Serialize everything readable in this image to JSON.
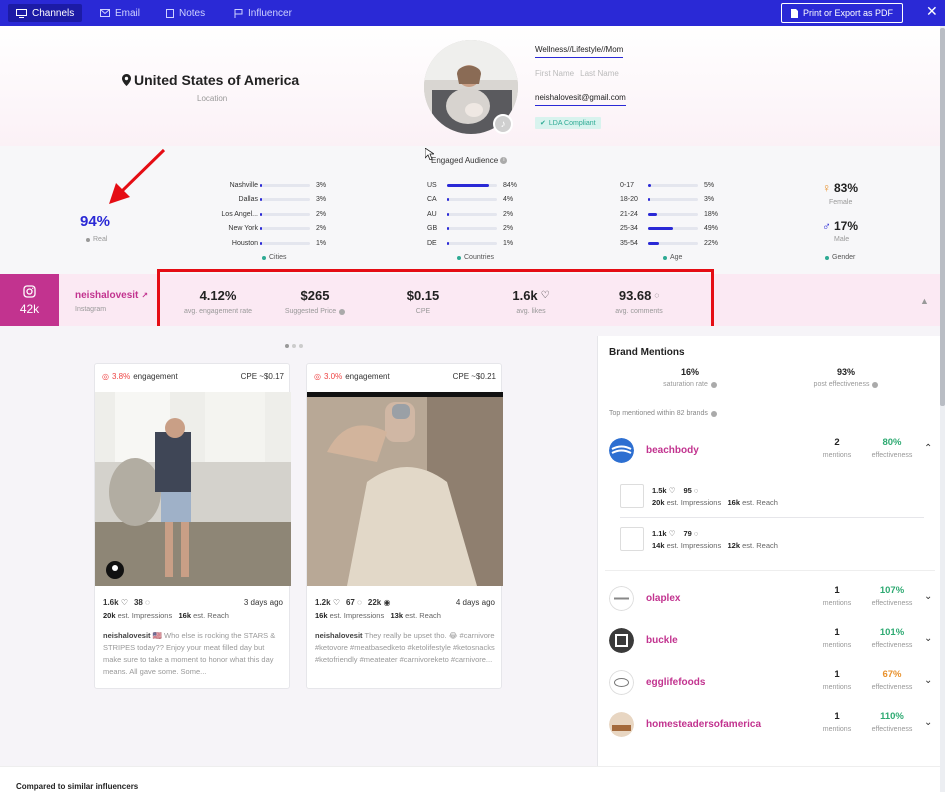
{
  "topbar": {
    "tabs": [
      {
        "label": "Channels",
        "icon": "monitor-icon",
        "active": true
      },
      {
        "label": "Email",
        "icon": "mail-icon"
      },
      {
        "label": "Notes",
        "icon": "note-icon"
      },
      {
        "label": "Influencer",
        "icon": "flag-icon"
      }
    ],
    "print_label": "Print or Export as PDF",
    "close_glyph": "✕"
  },
  "profile": {
    "location": "United States of America",
    "location_label": "Location",
    "category": "Wellness//Lifestyle//Mom",
    "first_name_placeholder": "First Name",
    "last_name_placeholder": "Last Name",
    "email": "neishalovesit@gmail.com",
    "lda": "LDA Compliant"
  },
  "audience": {
    "title": "Engaged Audience",
    "real": {
      "value": "94%",
      "label": "Real"
    },
    "cities": {
      "label": "Cities",
      "rows": [
        {
          "name": "Nashville",
          "pct": "3%",
          "fill": 0.03
        },
        {
          "name": "Dallas",
          "pct": "3%",
          "fill": 0.03
        },
        {
          "name": "Los Angel...",
          "pct": "2%",
          "fill": 0.02
        },
        {
          "name": "New York",
          "pct": "2%",
          "fill": 0.02
        },
        {
          "name": "Houston",
          "pct": "1%",
          "fill": 0.01
        }
      ]
    },
    "countries": {
      "label": "Countries",
      "rows": [
        {
          "name": "US",
          "pct": "84%",
          "fill": 0.84
        },
        {
          "name": "CA",
          "pct": "4%",
          "fill": 0.04
        },
        {
          "name": "AU",
          "pct": "2%",
          "fill": 0.02
        },
        {
          "name": "GB",
          "pct": "2%",
          "fill": 0.02
        },
        {
          "name": "DE",
          "pct": "1%",
          "fill": 0.01
        }
      ]
    },
    "age": {
      "label": "Age",
      "rows": [
        {
          "name": "0-17",
          "pct": "5%",
          "fill": 0.05
        },
        {
          "name": "18-20",
          "pct": "3%",
          "fill": 0.03
        },
        {
          "name": "21-24",
          "pct": "18%",
          "fill": 0.18
        },
        {
          "name": "25-34",
          "pct": "49%",
          "fill": 0.49
        },
        {
          "name": "35-54",
          "pct": "22%",
          "fill": 0.22
        }
      ]
    },
    "gender": {
      "label": "Gender",
      "female": {
        "value": "83%",
        "label": "Female",
        "color": "#e8912c"
      },
      "male": {
        "value": "17%",
        "label": "Male",
        "color": "#2a29d6"
      }
    }
  },
  "instagram": {
    "followers": "42k",
    "handle": "neishalovesit",
    "platform": "Instagram",
    "stats": [
      {
        "value": "4.12%",
        "label": "avg. engagement rate"
      },
      {
        "value": "$265",
        "label": "Suggested Price"
      },
      {
        "value": "$0.15",
        "label": "CPE"
      },
      {
        "value": "1.6k",
        "label": "avg. likes"
      },
      {
        "value": "93.68",
        "label": "avg. comments"
      }
    ]
  },
  "posts": [
    {
      "engagement_pct": "3.8%",
      "engagement_label": "engagement",
      "cpe": "CPE ~$0.17",
      "likes": "1.6k",
      "comments": "38",
      "age": "3 days ago",
      "impressions": "20k",
      "impressions_label": "est. Impressions",
      "reach": "16k",
      "reach_label": "est. Reach",
      "author": "neishalovesit",
      "caption": "🇺🇸 Who else is rocking the STARS & STRIPES today?? Enjoy your meat filled day but make sure to take a moment to honor what this day means. All gave some. Some..."
    },
    {
      "engagement_pct": "3.0%",
      "engagement_label": "engagement",
      "cpe": "CPE ~$0.21",
      "likes": "1.2k",
      "comments": "67",
      "views": "22k",
      "age": "4 days ago",
      "impressions": "16k",
      "impressions_label": "est. Impressions",
      "reach": "13k",
      "reach_label": "est. Reach",
      "author": "neishalovesit",
      "caption": "They really be upset tho. 😂 #carnivore #ketovore #meatbasedketo #ketolifestyle #ketosnacks #ketofriendly #meateater #carnivoreketo #carnivore..."
    }
  ],
  "brand_mentions": {
    "title": "Brand Mentions",
    "saturation": {
      "value": "16%",
      "label": "saturation rate"
    },
    "post_effectiveness": {
      "value": "93%",
      "label": "post effectiveness"
    },
    "top_label": "Top mentioned within 82 brands",
    "mentions_label": "mentions",
    "effectiveness_label": "effectiveness",
    "brands": [
      {
        "name": "beachbody",
        "mentions": "2",
        "effectiveness": "80%",
        "eff_color": "#2eaa72",
        "chevron": "⌃"
      },
      {
        "name": "olaplex",
        "mentions": "1",
        "effectiveness": "107%",
        "eff_color": "#2eaa72",
        "chevron": "⌄"
      },
      {
        "name": "buckle",
        "mentions": "1",
        "effectiveness": "101%",
        "eff_color": "#2eaa72",
        "chevron": "⌄"
      },
      {
        "name": "egglifefoods",
        "mentions": "1",
        "effectiveness": "67%",
        "eff_color": "#e8912c",
        "chevron": "⌄"
      },
      {
        "name": "homesteadersofamerica",
        "mentions": "1",
        "effectiveness": "110%",
        "eff_color": "#2eaa72",
        "chevron": "⌄"
      }
    ],
    "beachbody_posts": [
      {
        "likes": "1.5k",
        "comments": "95",
        "impressions": "20k",
        "impressions_label": "est. Impressions",
        "reach": "16k",
        "reach_label": "est. Reach"
      },
      {
        "likes": "1.1k",
        "comments": "79",
        "impressions": "14k",
        "impressions_label": "est. Impressions",
        "reach": "12k",
        "reach_label": "est. Reach"
      }
    ]
  },
  "footer": {
    "compared": "Compared to similar influencers"
  }
}
